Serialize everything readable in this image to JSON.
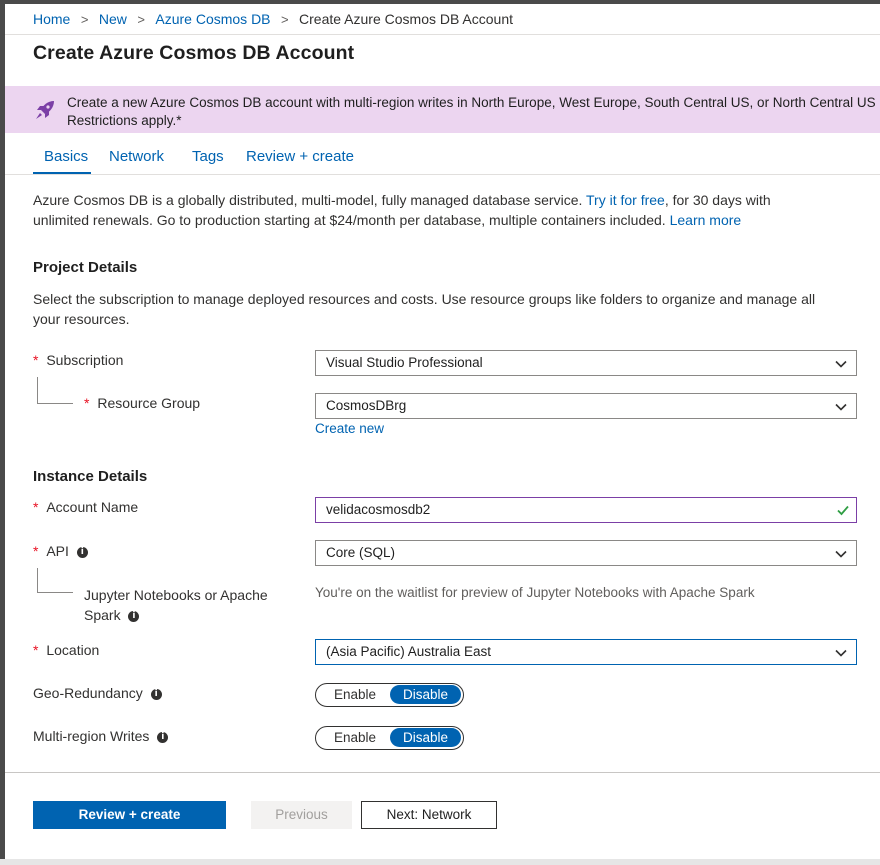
{
  "breadcrumb": {
    "items": [
      "Home",
      "New",
      "Azure Cosmos DB"
    ],
    "current": "Create Azure Cosmos DB Account",
    "separator": ">"
  },
  "page_title": "Create Azure Cosmos DB Account",
  "banner": {
    "icon": "rocket-icon",
    "line1": "Create a new Azure Cosmos DB account with multi-region writes in North Europe, West Europe, South Central US, or North Central US by",
    "line2": "Restrictions apply.*"
  },
  "tabs": [
    {
      "label": "Basics",
      "selected": true
    },
    {
      "label": "Network",
      "selected": false
    },
    {
      "label": "Tags",
      "selected": false
    },
    {
      "label": "Review + create",
      "selected": false
    }
  ],
  "intro": {
    "part1": "Azure Cosmos DB is a globally distributed, multi-model, fully managed database service. ",
    "try_link": "Try it for free",
    "part2": ", for 30 days with",
    "part3": "unlimited renewals. Go to production starting at $24/month per database, multiple containers included. ",
    "learn_link": "Learn more"
  },
  "project_details": {
    "heading": "Project Details",
    "description_line1": "Select the subscription to manage deployed resources and costs. Use resource groups like folders to organize and manage all",
    "description_line2": "your resources.",
    "subscription": {
      "label": "Subscription",
      "value": "Visual Studio Professional"
    },
    "resource_group": {
      "label": "Resource Group",
      "value": "CosmosDBrg",
      "create_new": "Create new"
    }
  },
  "instance_details": {
    "heading": "Instance Details",
    "account_name": {
      "label": "Account Name",
      "value": "velidacosmosdb2"
    },
    "api": {
      "label": "API",
      "value": "Core (SQL)"
    },
    "jupyter": {
      "label_line1": "Jupyter Notebooks or Apache",
      "label_line2": "Spark",
      "note": "You're on the waitlist for preview of Jupyter Notebooks with Apache Spark"
    },
    "location": {
      "label": "Location",
      "value": "(Asia Pacific) Australia East"
    },
    "geo_redundancy": {
      "label": "Geo-Redundancy",
      "enable": "Enable",
      "disable": "Disable",
      "selected": "Disable"
    },
    "multi_region_writes": {
      "label": "Multi-region Writes",
      "enable": "Enable",
      "disable": "Disable",
      "selected": "Disable"
    }
  },
  "required_marker": "*",
  "info_glyph": "i",
  "footer": {
    "review_create": "Review + create",
    "previous": "Previous",
    "next": "Next: Network"
  },
  "colors": {
    "accent": "#0063b1",
    "banner_bg": "#ecd5f0",
    "required": "#e81123",
    "valid_check": "#2f9e44",
    "focus_border": "#7b3fa6"
  }
}
